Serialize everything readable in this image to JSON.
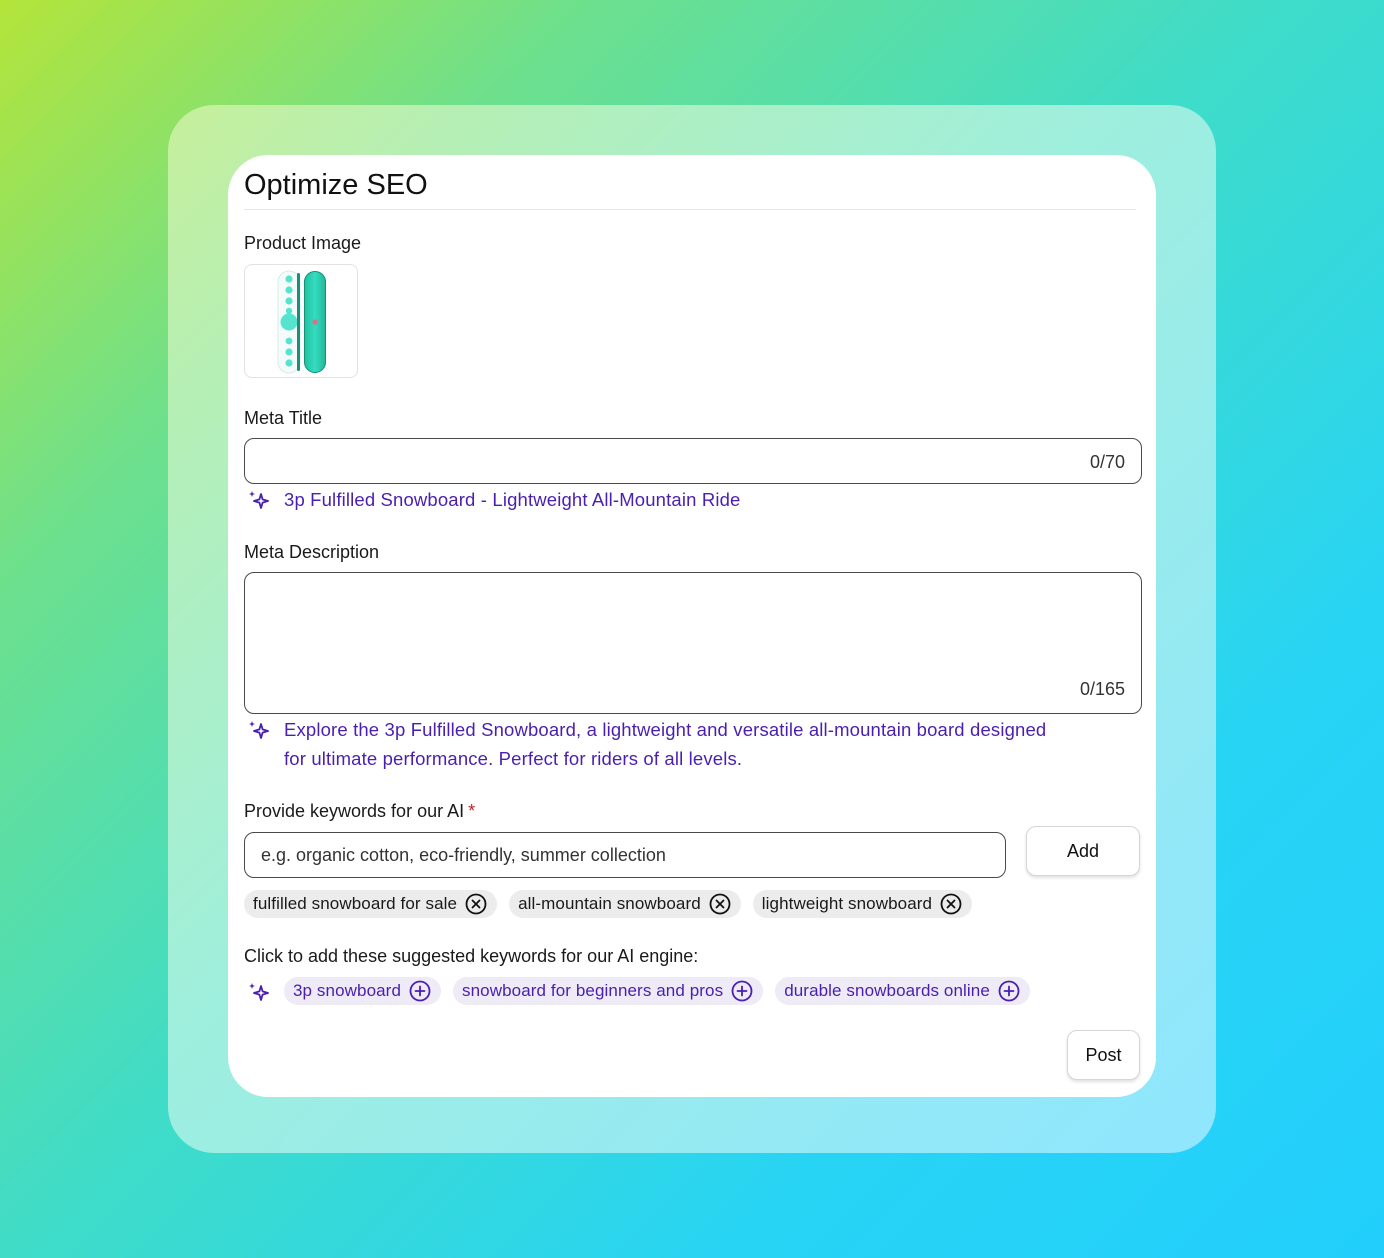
{
  "panel": {
    "title": "Optimize SEO"
  },
  "product_image": {
    "label": "Product Image"
  },
  "meta_title": {
    "label": "Meta Title",
    "value": "",
    "counter": "0/70",
    "ai_suggestion": "3p Fulfilled Snowboard - Lightweight All-Mountain Ride"
  },
  "meta_description": {
    "label": "Meta Description",
    "value": "",
    "counter": "0/165",
    "ai_suggestion_line1": "Explore the 3p Fulfilled Snowboard, a lightweight and versatile all-mountain board designed",
    "ai_suggestion_line2": "for ultimate performance. Perfect for riders of all levels."
  },
  "keywords": {
    "label": "Provide keywords for our AI",
    "required_mark": "*",
    "placeholder": "e.g. organic cotton, eco-friendly, summer collection",
    "add_button": "Add",
    "selected": [
      "fulfilled snowboard for sale",
      "all-mountain snowboard",
      "lightweight snowboard"
    ]
  },
  "suggestions": {
    "label": "Click to add these suggested keywords for our AI engine:",
    "items": [
      "3p snowboard",
      "snowboard for beginners and pros",
      "durable snowboards online"
    ]
  },
  "actions": {
    "post_button": "Post"
  },
  "colors": {
    "accent": "#4a1fb0",
    "required": "#c81e1e",
    "chip_bg": "#ececec",
    "suggest_chip_bg": "#eeeaf6",
    "board_teal": "#2ed3b0"
  },
  "icons": {
    "ai": "sparkle-icon",
    "remove": "close-circle-icon",
    "add": "plus-circle-icon"
  }
}
